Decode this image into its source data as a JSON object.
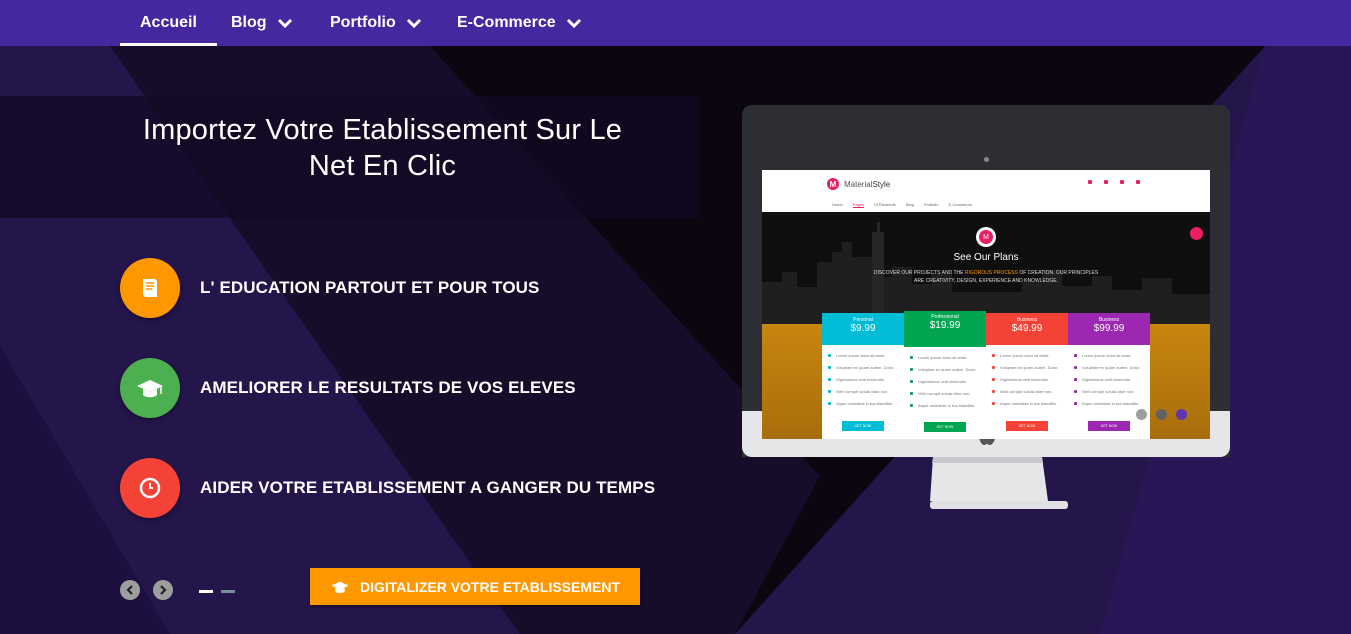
{
  "nav": {
    "items": [
      {
        "label": "Accueil",
        "active": true,
        "dropdown": false
      },
      {
        "label": "Blog",
        "active": false,
        "dropdown": true
      },
      {
        "label": "Portfolio",
        "active": false,
        "dropdown": true
      },
      {
        "label": "E-Commerce",
        "active": false,
        "dropdown": true
      }
    ]
  },
  "hero": {
    "headline_line1": "Importez Votre Etablissement Sur Le",
    "headline_line2": "Net En Clic",
    "features": [
      {
        "label": "L' EDUCATION PARTOUT ET POUR TOUS",
        "icon": "book-icon",
        "color": "#ff9800"
      },
      {
        "label": "AMELIORER LE RESULTATS DE VOS ELEVES",
        "icon": "graduation-cap-icon",
        "color": "#4caf50"
      },
      {
        "label": "AIDER VOTRE ETABLISSEMENT A GANGER DU TEMPS",
        "icon": "clock-icon",
        "color": "#f44336"
      }
    ],
    "cta_label": "DIGITALIZER VOTRE ETABLISSEMENT",
    "slider": {
      "pages": 2,
      "current": 1
    }
  },
  "mockup": {
    "brand_first": "Material",
    "brand_second": "Style",
    "logo_letter": "M",
    "nav": [
      "Home",
      "Pages",
      "UI Elements",
      "Blog",
      "Portfolio",
      "E-Commerce"
    ],
    "title": "See Our Plans",
    "sub_before": "DISCOVER OUR PROJECTS AND THE ",
    "sub_highlight": "RIGOROUS PROCESS",
    "sub_after": " OF CREATION. OUR PRINCIPLES ARE CREATIVITY, DESIGN, EXPERIENCE AND KNOWLEDGE.",
    "plans": [
      {
        "name": "Personal",
        "price": "9.99",
        "color": "#00bcd4",
        "button": "GET NOW"
      },
      {
        "name": "Professional",
        "price": "19.99",
        "color": "#00a651",
        "button": "GET NOW"
      },
      {
        "name": "Business",
        "price": "49.99",
        "color": "#f44336",
        "button": "GET NOW"
      },
      {
        "name": "Business",
        "price": "99.99",
        "color": "#9c27b0",
        "button": "GET NOW"
      }
    ],
    "plan_features": [
      "Lorem ipsum dolor sit amet.",
      "Voluptate ex quam autem. Dolor.",
      "Dignissimos velit reiciendis.",
      "Nihil corrupti soluta vitae non.",
      "Atque molestiae in tua blanditiis."
    ]
  },
  "carousel_dots": {
    "count": 3,
    "active": 3
  }
}
